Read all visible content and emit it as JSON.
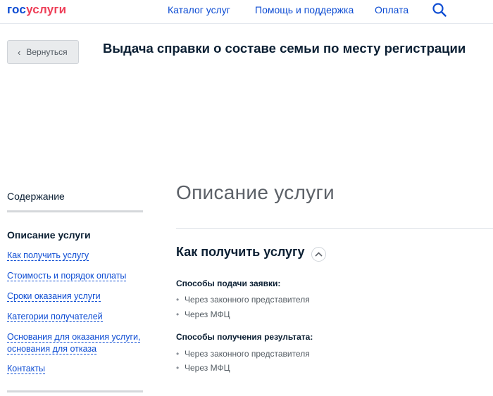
{
  "header": {
    "logo_part1": "гос",
    "logo_part2": "услуги",
    "nav": [
      "Каталог услуг",
      "Помощь и поддержка",
      "Оплата"
    ]
  },
  "back_button": {
    "label": "Вернуться"
  },
  "page_title": "Выдача справки о составе семьи по месту регистрации",
  "sidebar": {
    "heading": "Содержание",
    "active": "Описание услуги",
    "items": [
      "Как получить услугу",
      "Стоимость и порядок оплаты",
      "Сроки оказания услуги",
      "Категории получателей",
      "Основания для оказания услуги,",
      "основания для отказа",
      "Контакты"
    ]
  },
  "main": {
    "section_title": "Описание услуги",
    "sub_title": "Как получить услугу",
    "groups": [
      {
        "label": "Способы подачи заявки:",
        "items": [
          "Через законного представителя",
          "Через МФЦ"
        ]
      },
      {
        "label": "Способы получения результата:",
        "items": [
          "Через законного представителя",
          "Через МФЦ"
        ]
      }
    ]
  },
  "colors": {
    "brand_blue": "#0d4cd3",
    "brand_red": "#ee3f58",
    "text_dark": "#0b1f33",
    "text_grey": "#5c6168"
  }
}
